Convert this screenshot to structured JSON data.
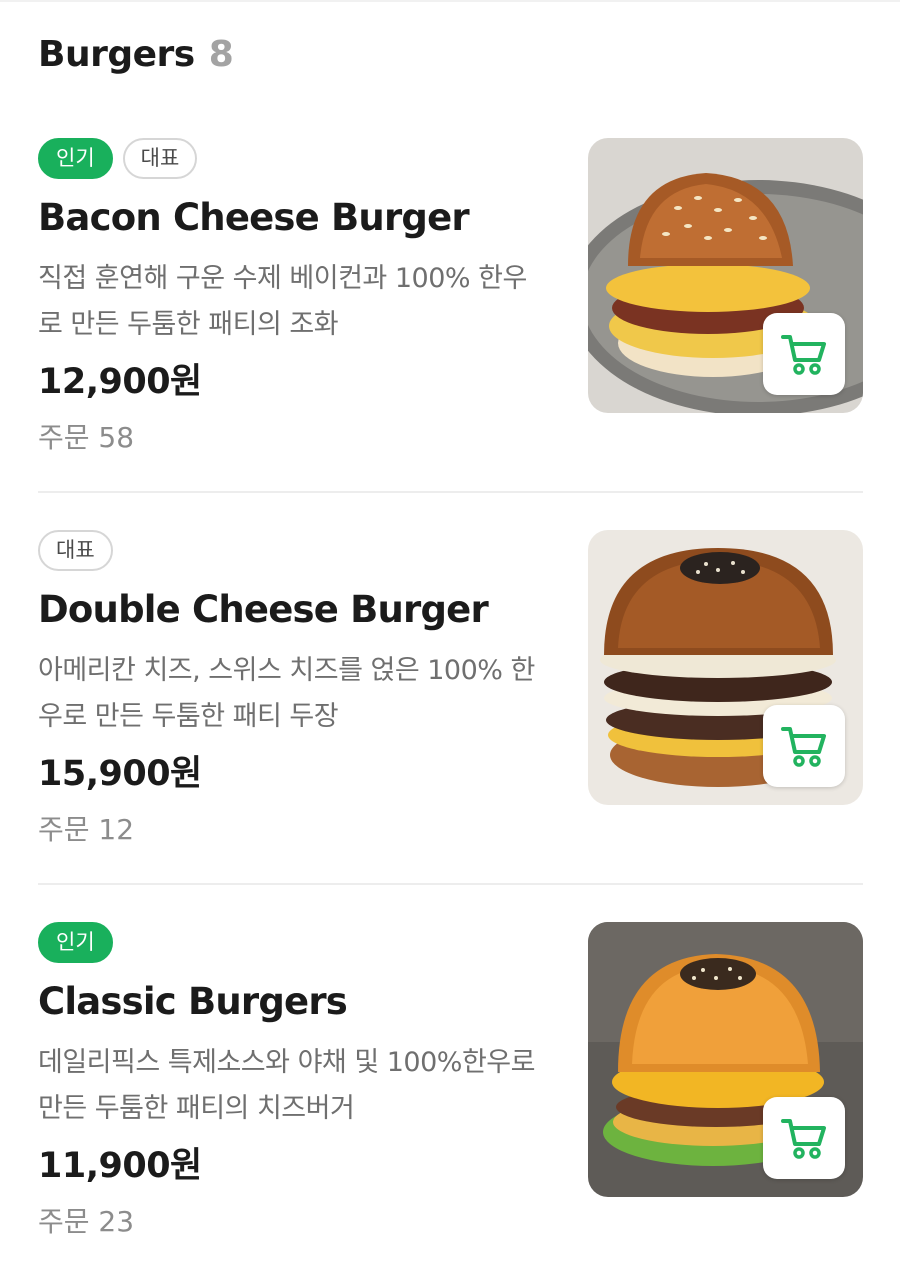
{
  "section": {
    "title": "Burgers",
    "count": "8"
  },
  "items": [
    {
      "badges": [
        "인기",
        "대표"
      ],
      "name": "Bacon Cheese Burger",
      "description": "직접 훈연해 구운 수제 베이컨과 100% 한우로 만든 두툼한 패티의 조화",
      "price": "12,900원",
      "orders": "주문 58"
    },
    {
      "badges": [
        "대표"
      ],
      "name": "Double Cheese Burger",
      "description": "아메리칸 치즈, 스위스 치즈를 얹은 100% 한우로 만든 두툼한 패티 두장",
      "price": "15,900원",
      "orders": "주문 12"
    },
    {
      "badges": [
        "인기"
      ],
      "name": "Classic Burgers",
      "description": "데일리픽스 특제소스와 야채 및 100%한우로 만든 두툼한 패티의 치즈버거",
      "price": "11,900원",
      "orders": "주문 23"
    }
  ],
  "colors": {
    "accent": "#19b05c",
    "cart_icon": "#22b35f"
  },
  "icons": {
    "cart": "cart-icon"
  }
}
